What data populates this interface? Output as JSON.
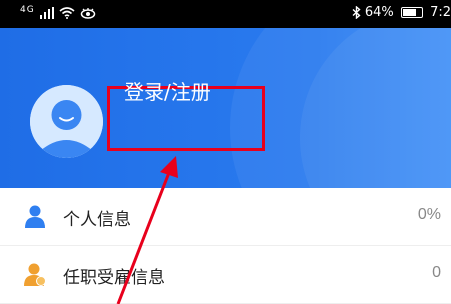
{
  "status_bar": {
    "left": "4G",
    "battery_percent": "64%",
    "time": "7:2"
  },
  "header": {
    "login_label": "登录/注册"
  },
  "menu": [
    {
      "label": "个人信息",
      "value": "0%",
      "icon": "person-icon",
      "icon_color": "#2f7ff0"
    },
    {
      "label": "任职受雇信息",
      "value": "0",
      "icon": "employee-badge-icon",
      "icon_color": "#f0a030"
    }
  ],
  "colors": {
    "header_blue": "#2a7bef",
    "highlight_red": "#e8001c"
  }
}
